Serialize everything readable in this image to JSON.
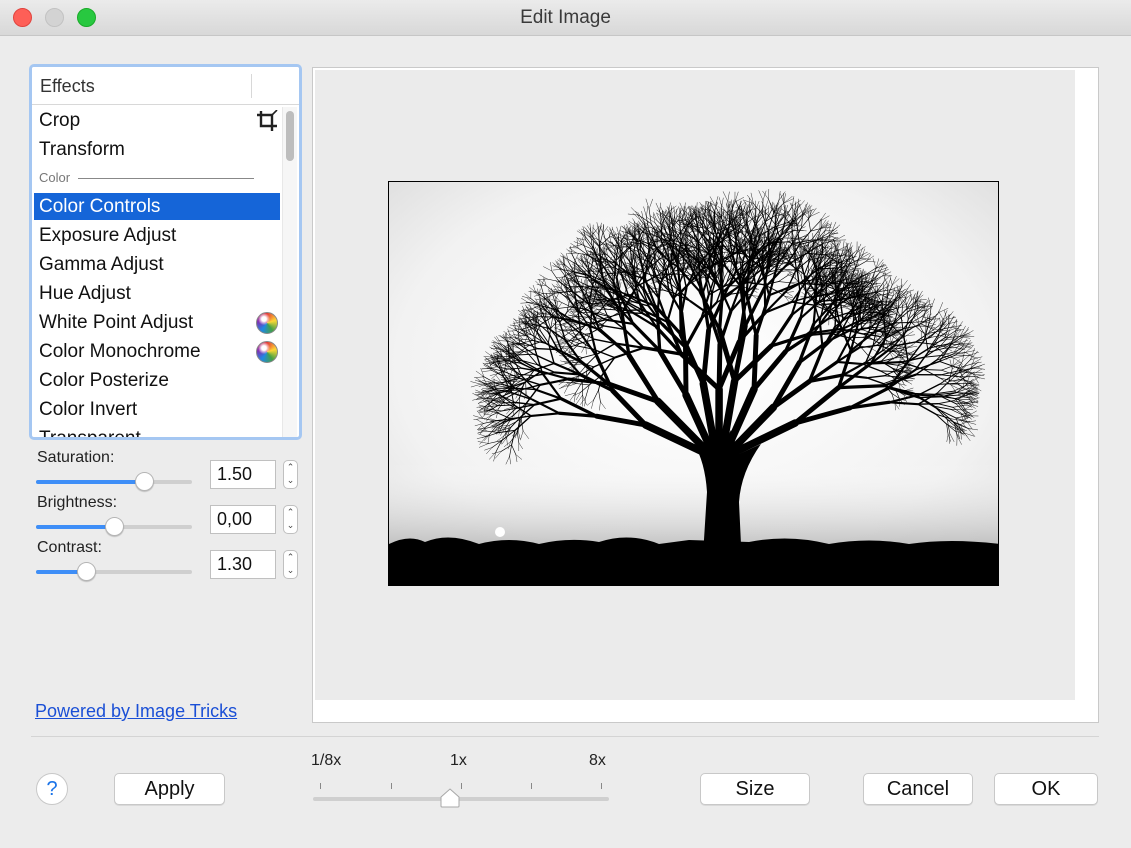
{
  "window": {
    "title": "Edit Image"
  },
  "effects": {
    "header": "Effects",
    "items": [
      {
        "label": "Crop",
        "icon": "crop-icon"
      },
      {
        "label": "Transform"
      },
      {
        "label": "Color",
        "group": true
      },
      {
        "label": "Color Controls",
        "selected": true
      },
      {
        "label": "Exposure Adjust"
      },
      {
        "label": "Gamma Adjust"
      },
      {
        "label": "Hue Adjust"
      },
      {
        "label": "White Point Adjust",
        "icon": "color-wheel-icon"
      },
      {
        "label": "Color Monochrome",
        "icon": "color-wheel-icon"
      },
      {
        "label": "Color Posterize"
      },
      {
        "label": "Color Invert"
      },
      {
        "label": "Transparent"
      }
    ]
  },
  "adjustments": {
    "saturation": {
      "label": "Saturation:",
      "value": "1.50",
      "level": 0.72
    },
    "brightness": {
      "label": "Brightness:",
      "value": "0,00",
      "level": 0.5
    },
    "contrast": {
      "label": "Contrast:",
      "value": "1.30",
      "level": 0.3
    }
  },
  "powered_by": "Powered by Image Tricks",
  "zoom": {
    "min_label": "1/8x",
    "mid_label": "1x",
    "max_label": "8x",
    "level": 0.46
  },
  "buttons": {
    "help": "?",
    "apply": "Apply",
    "size": "Size",
    "cancel": "Cancel",
    "ok": "OK"
  },
  "colors": {
    "selection": "#1565d8",
    "slider_fill": "#3e8ef7",
    "focus_ring": "#a5c7f2",
    "link": "#1a4fd6"
  }
}
